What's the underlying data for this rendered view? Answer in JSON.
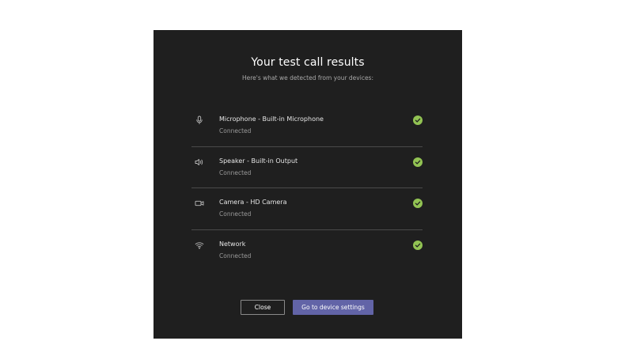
{
  "dialog": {
    "title": "Your test call results",
    "subtitle": "Here's what we detected from your devices:",
    "devices": [
      {
        "icon": "microphone-icon",
        "label": "Microphone - Built-in Microphone",
        "status": "Connected"
      },
      {
        "icon": "speaker-icon",
        "label": "Speaker - Built-in Output",
        "status": "Connected"
      },
      {
        "icon": "camera-icon",
        "label": "Camera - HD Camera",
        "status": "Connected"
      },
      {
        "icon": "wifi-icon",
        "label": "Network",
        "status": "Connected"
      }
    ],
    "buttons": {
      "close": "Close",
      "settings": "Go to device settings"
    }
  },
  "colors": {
    "background": "#1f1f1f",
    "success": "#92c353",
    "accent": "#6264a7"
  }
}
